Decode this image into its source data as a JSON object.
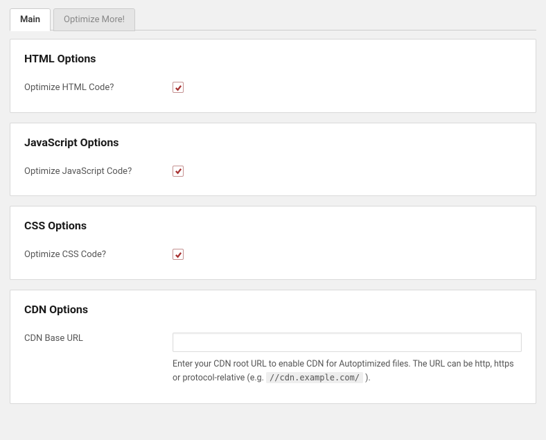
{
  "tabs": {
    "main": "Main",
    "optimizeMore": "Optimize More!"
  },
  "sections": {
    "html": {
      "title": "HTML Options",
      "optimize_label": "Optimize HTML Code?",
      "optimize_checked": true
    },
    "js": {
      "title": "JavaScript Options",
      "optimize_label": "Optimize JavaScript Code?",
      "optimize_checked": true
    },
    "css": {
      "title": "CSS Options",
      "optimize_label": "Optimize CSS Code?",
      "optimize_checked": true
    },
    "cdn": {
      "title": "CDN Options",
      "base_url_label": "CDN Base URL",
      "base_url_value": "",
      "help_pre": "Enter your CDN root URL to enable CDN for Autoptimized files. The URL can be http, https or protocol-relative (e.g. ",
      "help_code": "//cdn.example.com/",
      "help_post": " )."
    }
  }
}
